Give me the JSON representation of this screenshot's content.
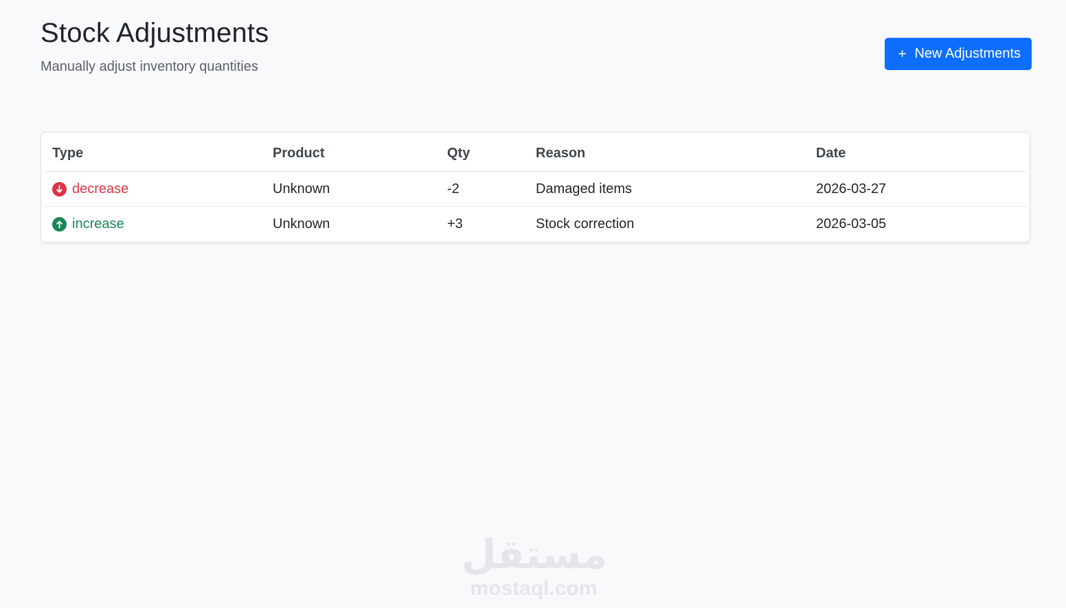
{
  "header": {
    "title": "Stock Adjustments",
    "subtitle": "Manually adjust inventory quantities",
    "new_button_label": "New Adjustments",
    "new_button_icon": "plus-icon"
  },
  "table": {
    "columns": [
      "Type",
      "Product",
      "Qty",
      "Reason",
      "Date"
    ],
    "rows": [
      {
        "type": "decrease",
        "type_icon": "arrow-down-circle-icon",
        "type_color": "#dc3545",
        "product": "Unknown",
        "qty": "-2",
        "reason": "Damaged items",
        "date": "2026-03-27"
      },
      {
        "type": "increase",
        "type_icon": "arrow-up-circle-icon",
        "type_color": "#198754",
        "product": "Unknown",
        "qty": "+3",
        "reason": "Stock correction",
        "date": "2026-03-05"
      }
    ]
  },
  "watermark": {
    "logo_text": "مستقل",
    "url": "mostaql.com"
  },
  "colors": {
    "accent": "#0d6efd",
    "background": "#f8f9fb"
  }
}
